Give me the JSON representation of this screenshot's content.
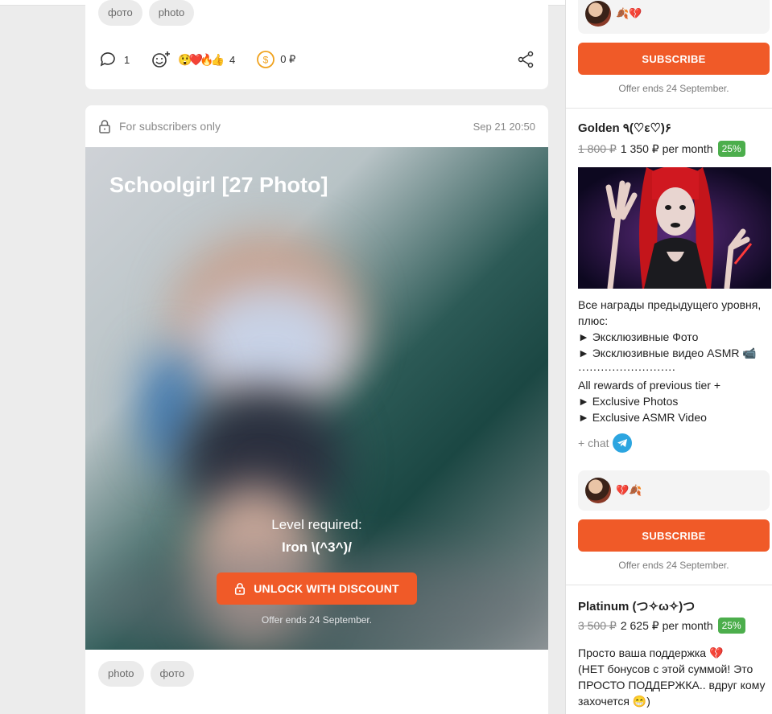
{
  "post_top": {
    "tags": [
      "фото",
      "photo"
    ],
    "comments_count": "1",
    "reactions_emoji": "😲❤️🔥👍",
    "reactions_count": "4",
    "donations": "0 ₽"
  },
  "post": {
    "visibility": "For subscribers only",
    "date": "Sep 21 20:50",
    "title": "Schoolgirl [27 Photo]",
    "level_label": "Level required:",
    "level_name": "Iron \\(^3^)/",
    "unlock_label": "UNLOCK WITH DISCOUNT",
    "offer_note": "Offer ends 24 September.",
    "tags": [
      "photo",
      "фото"
    ]
  },
  "sidebar": {
    "tier_prev": {
      "supporter_emoji": "🍂💔",
      "subscribe_label": "SUBSCRIBE",
      "offer": "Offer ends 24 September."
    },
    "tier_golden": {
      "name": "Golden ٩(♡ε♡)۶",
      "old_price": "1 800 ₽",
      "price": "1 350 ₽ per month",
      "discount": "25%",
      "description": "Все награды предыдущего уровня, плюс:\n► Эксклюзивные Фото\n► Эксклюзивные видео ASMR 📹\n··························\n All rewards of previous tier +\n► Exclusive Photos\n► Exclusive ASMR Video",
      "chat_label": "+ chat",
      "supporter_emoji": "💔🍂",
      "subscribe_label": "SUBSCRIBE",
      "offer": "Offer ends 24 September."
    },
    "tier_platinum": {
      "name": "Platinum (つ✧ω✧)つ",
      "old_price": "3 500 ₽",
      "price": "2 625 ₽ per month",
      "discount": "25%",
      "description": "Просто ваша поддержка 💔\n(НЕТ бонусов с этой суммой! Это ПРОСТО ПОДДЕРЖКА.. вдруг кому захочется 😁)"
    }
  },
  "colors": {
    "accent": "#f05a28",
    "discount": "#4cae4c",
    "telegram": "#2ca5e0"
  }
}
